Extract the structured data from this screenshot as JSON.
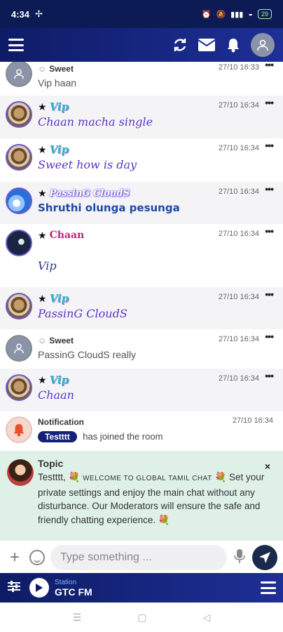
{
  "status_bar": {
    "time": "4:34",
    "battery": "29"
  },
  "app_bar": {
    "menu_icon": "hamburger-icon",
    "refresh_icon": "refresh-icon",
    "mail_icon": "mail-icon",
    "bell_icon": "bell-icon",
    "avatar_icon": "user-avatar-icon"
  },
  "messages": [
    {
      "user": "Sweet",
      "time": "27/10 16:33",
      "text": "Vip haan"
    },
    {
      "user": "Vip",
      "time": "27/10 16:34",
      "text": "Chaan macha single"
    },
    {
      "user": "Vip",
      "time": "27/10 16:34",
      "text": "Sweet how is day"
    },
    {
      "user": "PassinG CloudS",
      "time": "27/10 16:34",
      "text": "Shruthi olunga pesunga"
    },
    {
      "user": "Chaan",
      "time": "27/10 16:34",
      "text": "Vip"
    },
    {
      "user": "Vip",
      "time": "27/10 16:34",
      "text": "PassinG CloudS"
    },
    {
      "user": "Sweet",
      "time": "27/10 16:34",
      "text": "PassinG CloudS really"
    },
    {
      "user": "Vip",
      "time": "27/10 16:34",
      "text": "Chaan"
    }
  ],
  "notification": {
    "title": "Notification",
    "time": "27/10 16:34",
    "badge": "Testttt",
    "text": "has joined the room"
  },
  "topic": {
    "title": "Topic",
    "close": "×",
    "line1_start": "Testttt, ",
    "line1_caps": "WELCOME TO GLOBAL TAMIL CHAT",
    "line1_end": " Set",
    "body_rest": "your private settings and enjoy the main chat without any disturbance. Our Moderators will ensure the safe and friendly chatting experience."
  },
  "input": {
    "placeholder": "Type something ..."
  },
  "player": {
    "station_label": "Station",
    "station_name": "GTC FM"
  },
  "colors": {
    "bar": "#0e1c66",
    "accent": "#5a34c8",
    "topic_bg": "#dff1e6"
  }
}
